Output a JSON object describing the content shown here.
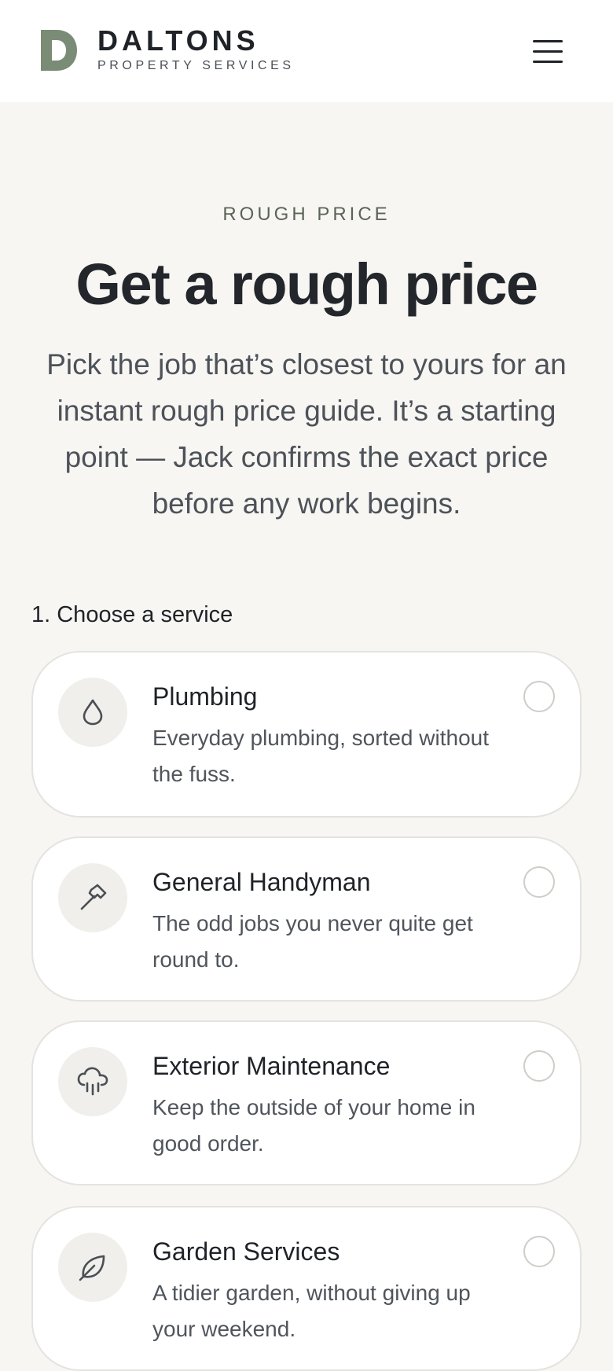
{
  "header": {
    "brand_name": "DALTONS",
    "brand_sub": "PROPERTY SERVICES",
    "logo_letter": "D",
    "logo_color": "#7a8c76",
    "menu_icon": "hamburger-menu-icon"
  },
  "hero": {
    "eyebrow": "ROUGH PRICE",
    "title": "Get a rough price",
    "intro": "Pick the job that’s closest to yours for an instant rough price guide. It’s a starting point — Jack confirms the exact price before any work begins."
  },
  "step": {
    "label": "1. Choose a service"
  },
  "services": [
    {
      "title": "Plumbing",
      "description": "Everyday plumbing, sorted without the fuss.",
      "icon": "water-drop-icon",
      "selected": false
    },
    {
      "title": "General Handyman",
      "description": "The odd jobs you never quite get round to.",
      "icon": "hammer-icon",
      "selected": false
    },
    {
      "title": "Exterior Maintenance",
      "description": "Keep the outside of your home in good order.",
      "icon": "rain-cloud-icon",
      "selected": false
    },
    {
      "title": "Garden Services",
      "description": "A tidier garden, without giving up your weekend.",
      "icon": "leaf-icon",
      "selected": false
    }
  ],
  "colors": {
    "accent": "#7a8c76",
    "background": "#f7f6f3",
    "card": "#ffffff",
    "text": "#1f2328"
  }
}
